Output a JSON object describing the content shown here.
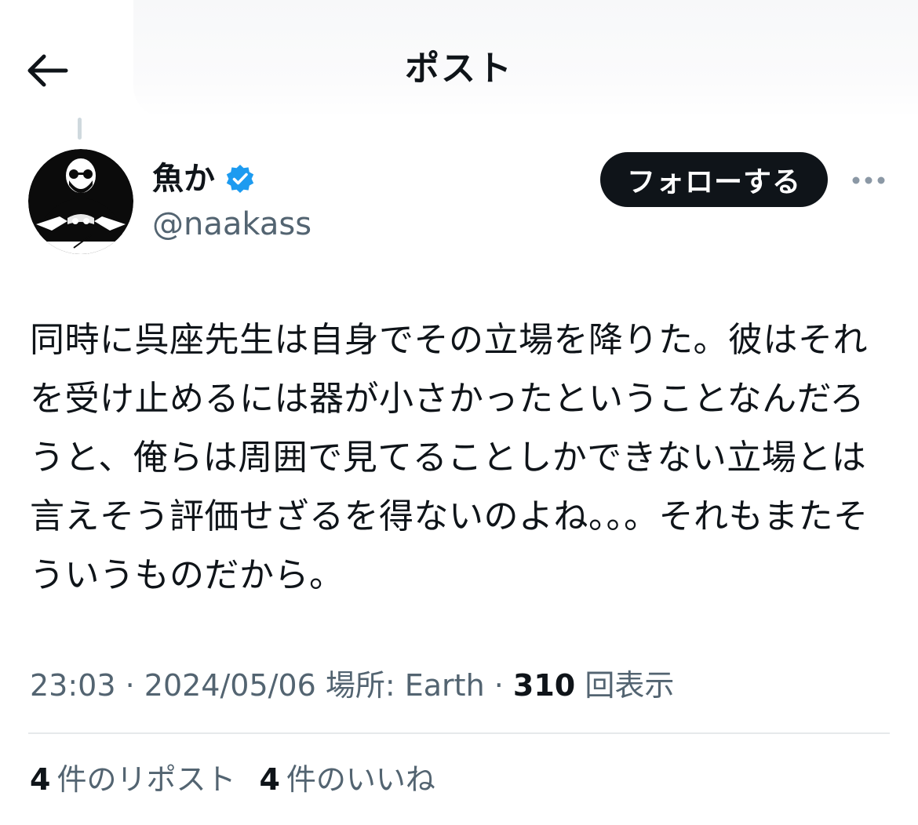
{
  "header": {
    "title": "ポスト",
    "back_icon": "arrow-left-icon"
  },
  "author": {
    "display_name": "魚か",
    "handle": "@naakass",
    "verified": true,
    "verified_color": "#1d9bf0",
    "avatar_icon": "profile-avatar"
  },
  "actions": {
    "follow_label": "フォローする",
    "more_icon": "more-dots-icon"
  },
  "tweet": {
    "text": "同時に呉座先生は自身でその立場を降りた。彼はそれを受け止めるには器が小さかったということなんだろうと、俺らは周囲で見てることしかできない立場とは言えそう評価せざるを得ないのよね。。。それもまたそういうものだから。"
  },
  "meta": {
    "time": "23:03",
    "sep1": " · ",
    "date": "2024/05/06",
    "location": " 場所: Earth",
    "sep2": " · ",
    "views_count": "310",
    "views_label": " 回表示"
  },
  "stats": {
    "reposts_count": "4",
    "reposts_label": "件のリポスト",
    "likes_count": "4",
    "likes_label": "件のいいね"
  },
  "colors": {
    "text_primary": "#0f1419",
    "text_secondary": "#536471",
    "button_bg": "#0f1419",
    "divider": "#e6e9eb"
  }
}
